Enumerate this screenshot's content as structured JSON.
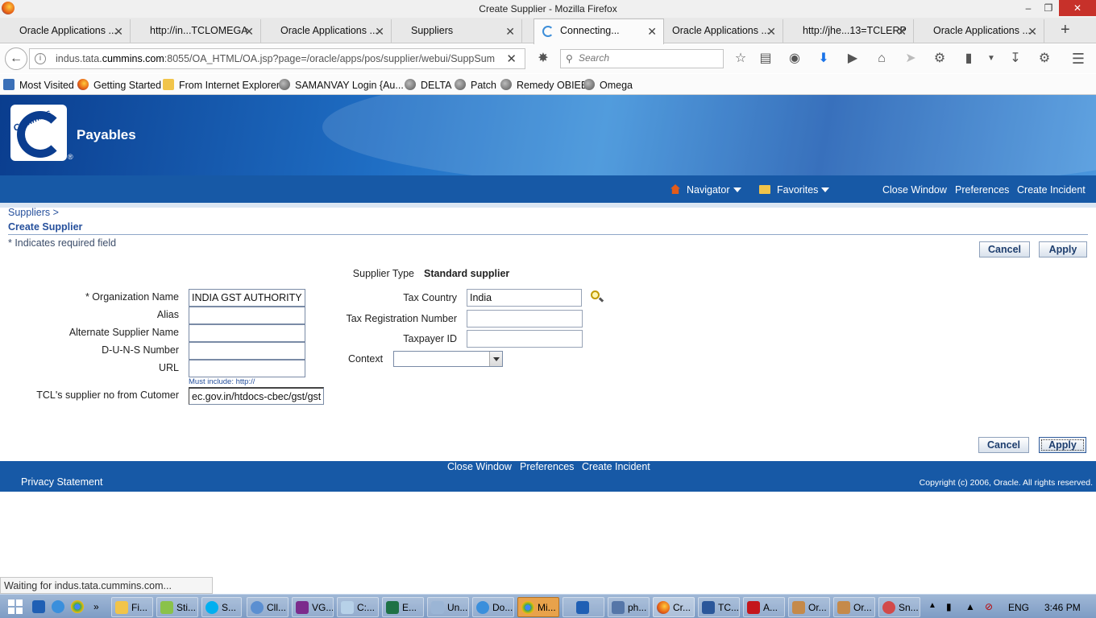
{
  "window": {
    "title": "Create Supplier - Mozilla Firefox"
  },
  "tabs": [
    "Oracle Applications ...",
    "http://in...TCLOMEGA",
    "Oracle Applications ...",
    "Suppliers",
    "Connecting...",
    "Oracle Applications ...",
    "http://jhe...13=TCLERP",
    "Oracle Applications ..."
  ],
  "navbar": {
    "url_prefix": "indus.tata.",
    "url_domain": "cummins.com",
    "url_rest": ":8055/OA_HTML/OA.jsp?page=/oracle/apps/pos/supplier/webui/SuppSum",
    "search_placeholder": "Search"
  },
  "bookmarks": [
    "Most Visited",
    "Getting Started",
    "From Internet Explorer",
    "SAMANVAY Login {Au...",
    "DELTA",
    "Patch",
    "Remedy OBIEE",
    "Omega"
  ],
  "header": {
    "app_name": "Payables",
    "logo_text": "Cummins",
    "registered": "®"
  },
  "global_nav": {
    "navigator": "Navigator",
    "favorites": "Favorites",
    "close_window": "Close Window",
    "preferences": "Preferences",
    "create_incident": "Create Incident"
  },
  "page": {
    "breadcrumb": "Suppliers  >",
    "title": "Create Supplier",
    "required_note": "*  Indicates required field",
    "cancel": "Cancel",
    "apply": "Apply"
  },
  "form": {
    "org_name_label": "* Organization Name",
    "org_name_value": "INDIA GST AUTHORITY",
    "alias_label": "Alias",
    "alt_name_label": "Alternate Supplier Name",
    "duns_label": "D-U-N-S Number",
    "url_label": "URL",
    "url_tip": "Must include: http://",
    "tcl_label": "TCL's supplier no from Cutomer",
    "tcl_value": "ec.gov.in/htdocs-cbec/gst/gst",
    "supplier_type_label": "Supplier Type",
    "supplier_type_value": "Standard supplier",
    "tax_country_label": "Tax Country",
    "tax_country_value": "India",
    "tax_reg_label": "Tax Registration Number",
    "taxpayer_label": "Taxpayer ID",
    "context_label": "Context"
  },
  "footer": {
    "close_window": "Close Window",
    "preferences": "Preferences",
    "create_incident": "Create Incident",
    "privacy": "Privacy Statement",
    "copyright": "Copyright (c) 2006, Oracle. All rights reserved."
  },
  "status": "Waiting for indus.tata.cummins.com...",
  "taskbar": {
    "items": [
      "Fi...",
      "Sti...",
      "S...",
      "Cll...",
      "VG...",
      "C:...",
      "E...",
      "Un...",
      "Do...",
      "Mi...",
      "",
      "ph...",
      "Cr...",
      "TC...",
      "A...",
      "Or...",
      "Or...",
      "Sn..."
    ],
    "lang": "ENG",
    "time": "3:46 PM"
  }
}
